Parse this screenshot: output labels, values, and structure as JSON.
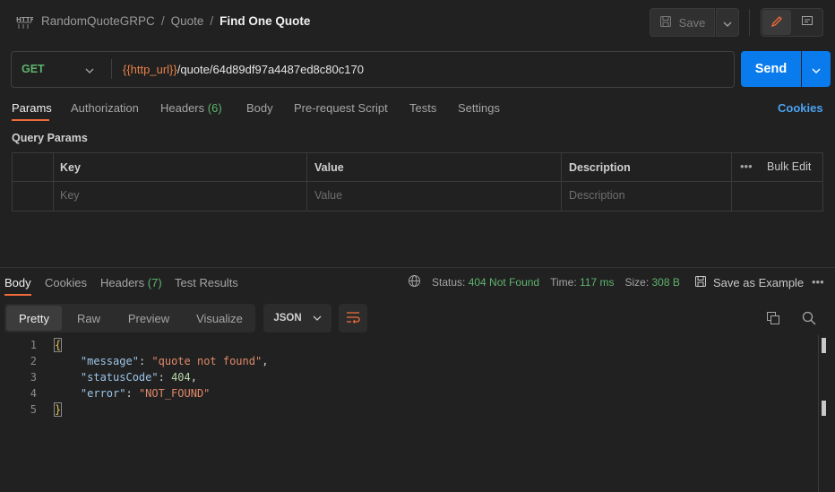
{
  "breadcrumb": {
    "collection": "RandomQuoteGRPC",
    "folder": "Quote",
    "request": "Find One Quote",
    "separator": "/"
  },
  "toolbar": {
    "save_label": "Save"
  },
  "request": {
    "method": "GET",
    "url_variable": "{{http_url}}",
    "url_path": "/quote/64d89df97a4487ed8c80c170",
    "send_label": "Send"
  },
  "request_tabs": [
    {
      "label": "Params",
      "count": ""
    },
    {
      "label": "Authorization",
      "count": ""
    },
    {
      "label": "Headers",
      "count": "(6)"
    },
    {
      "label": "Body",
      "count": ""
    },
    {
      "label": "Pre-request Script",
      "count": ""
    },
    {
      "label": "Tests",
      "count": ""
    },
    {
      "label": "Settings",
      "count": ""
    }
  ],
  "cookies_label": "Cookies",
  "query_params": {
    "title": "Query Params",
    "headers": {
      "key": "Key",
      "value": "Value",
      "description": "Description",
      "bulk_edit": "Bulk Edit"
    },
    "placeholders": {
      "key": "Key",
      "value": "Value",
      "description": "Description"
    }
  },
  "response_tabs": [
    {
      "label": "Body",
      "count": ""
    },
    {
      "label": "Cookies",
      "count": ""
    },
    {
      "label": "Headers",
      "count": "(7)"
    },
    {
      "label": "Test Results",
      "count": ""
    }
  ],
  "response_meta": {
    "status_label": "Status:",
    "status_value": "404 Not Found",
    "time_label": "Time:",
    "time_value": "117 ms",
    "size_label": "Size:",
    "size_value": "308 B",
    "save_example": "Save as Example"
  },
  "view_modes": [
    "Pretty",
    "Raw",
    "Preview",
    "Visualize"
  ],
  "format": "JSON",
  "response_body": {
    "line_numbers": [
      "1",
      "2",
      "3",
      "4",
      "5"
    ],
    "open_brace": "{",
    "close_brace": "}",
    "fields": [
      {
        "key": "\"message\"",
        "value": "\"quote not found\"",
        "type": "string",
        "trail": ","
      },
      {
        "key": "\"statusCode\"",
        "value": "404",
        "type": "number",
        "trail": ","
      },
      {
        "key": "\"error\"",
        "value": "\"NOT_FOUND\"",
        "type": "string",
        "trail": ""
      }
    ]
  },
  "colors": {
    "accent_orange": "#f26b3a",
    "send_blue": "#097bed",
    "success_green": "#5fb46c",
    "link_blue": "#4aa3f2"
  }
}
